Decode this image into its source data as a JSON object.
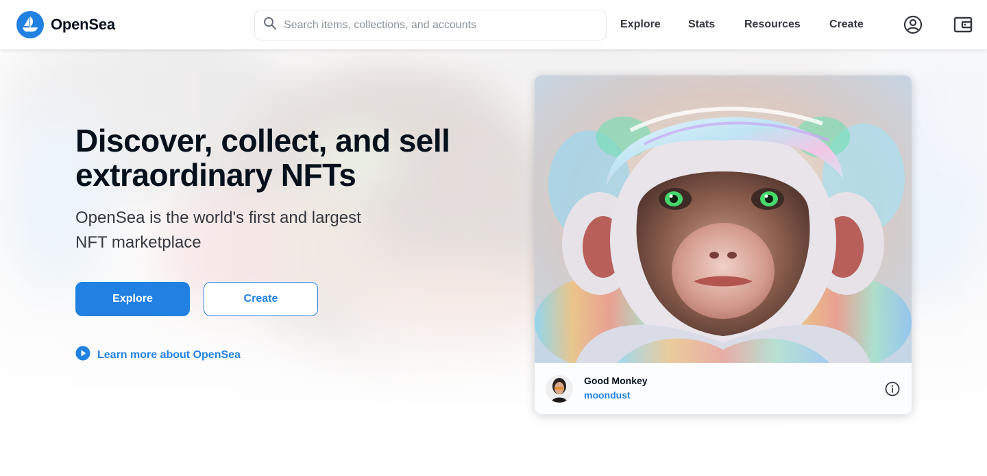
{
  "header": {
    "brand_name": "OpenSea",
    "search_placeholder": "Search items, collections, and accounts",
    "nav": {
      "explore": "Explore",
      "stats": "Stats",
      "resources": "Resources",
      "create": "Create"
    },
    "icons": [
      "opensea-logo-icon",
      "search-icon",
      "account-icon",
      "wallet-icon"
    ],
    "accent_color": "#2081e2"
  },
  "hero": {
    "headline": "Discover, collect, and sell extraordinary NFTs",
    "subheadline": "OpenSea is the world's first and largest NFT marketplace",
    "explore_button": "Explore",
    "create_button": "Create",
    "learn_more": "Learn more about OpenSea"
  },
  "featured": {
    "title": "Good Monkey",
    "creator": "moondust",
    "icons": [
      "creator-avatar",
      "info-icon"
    ]
  }
}
